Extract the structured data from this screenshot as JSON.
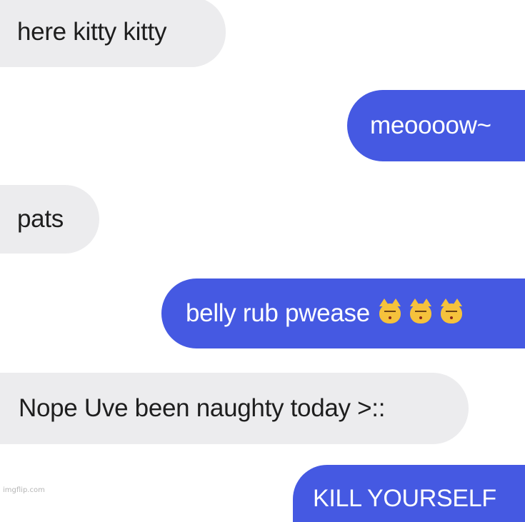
{
  "conversation": {
    "messages": [
      {
        "sender": "them",
        "text": "here kitty kitty"
      },
      {
        "sender": "me",
        "text": "meoooow~"
      },
      {
        "sender": "them",
        "text": "pats"
      },
      {
        "sender": "me",
        "text": "belly rub pwease",
        "emojis": [
          "kissing-cat-emoji",
          "kissing-cat-emoji",
          "kissing-cat-emoji"
        ]
      },
      {
        "sender": "them",
        "text": "Nope Uve been naughty today >::"
      },
      {
        "sender": "me",
        "text": "KILL YOURSELF"
      }
    ]
  },
  "colors": {
    "incoming_bubble": "#ececee",
    "outgoing_bubble": "#4559e2",
    "incoming_text": "#1e1e1e",
    "outgoing_text": "#ffffff"
  },
  "watermark": "imgflip.com"
}
